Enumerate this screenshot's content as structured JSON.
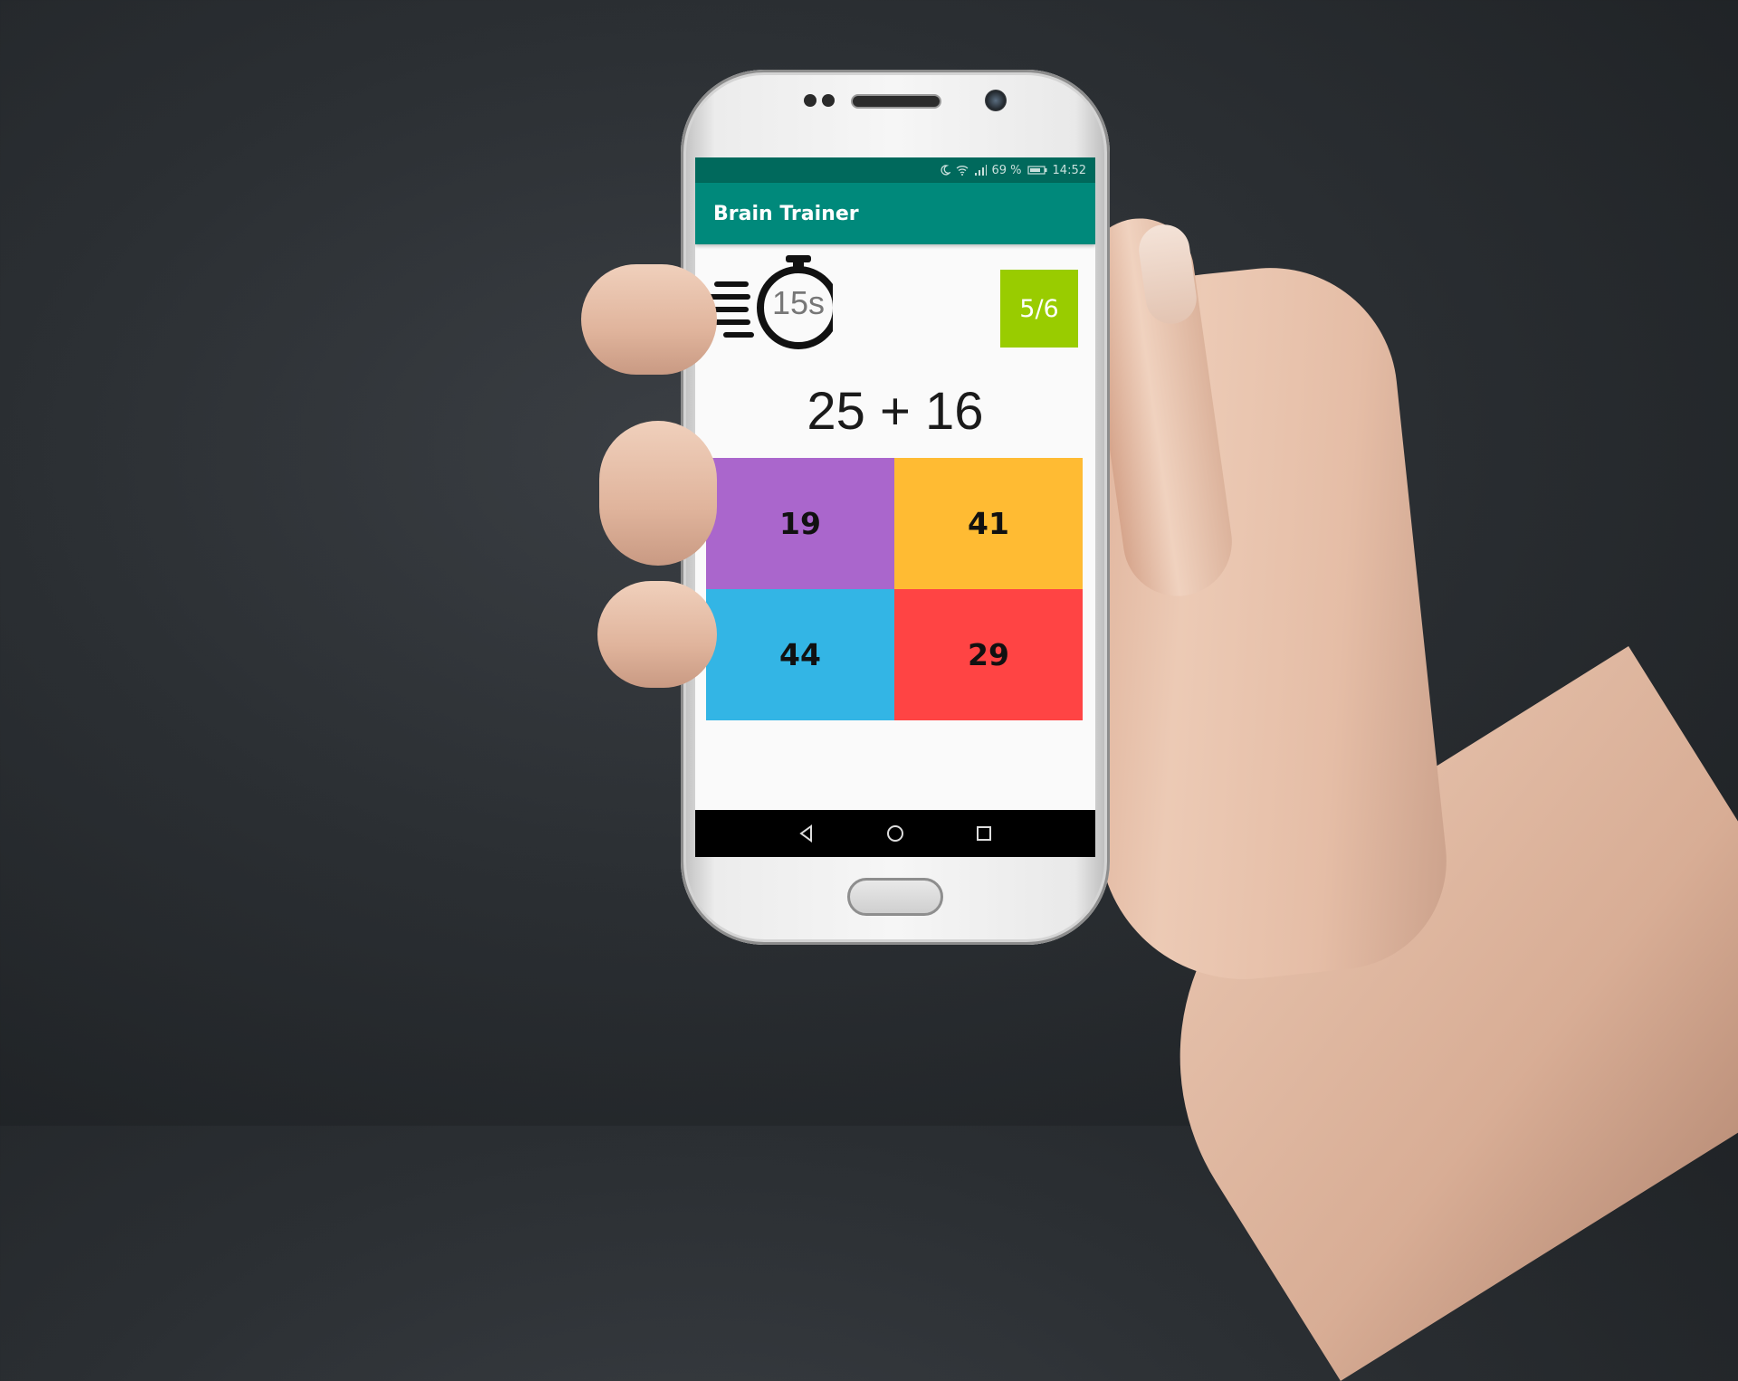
{
  "status_bar": {
    "battery": "69 %",
    "time": "14:52",
    "icons": [
      "moon-icon",
      "wifi-icon",
      "signal-icon",
      "battery-icon"
    ]
  },
  "app_bar": {
    "title": "Brain Trainer"
  },
  "game": {
    "timer_label": "15s",
    "score": "5/6",
    "question": "25 + 16",
    "answers": [
      {
        "value": "19",
        "color": "#aa66cc"
      },
      {
        "value": "41",
        "color": "#ffbb33"
      },
      {
        "value": "44",
        "color": "#33b5e5"
      },
      {
        "value": "29",
        "color": "#ff4444"
      }
    ],
    "colors": {
      "status_bar": "#00695c",
      "app_bar": "#00897b",
      "score_bg": "#99cc00"
    }
  },
  "nav": {
    "icons": [
      "back-icon",
      "home-icon",
      "recents-icon"
    ]
  }
}
